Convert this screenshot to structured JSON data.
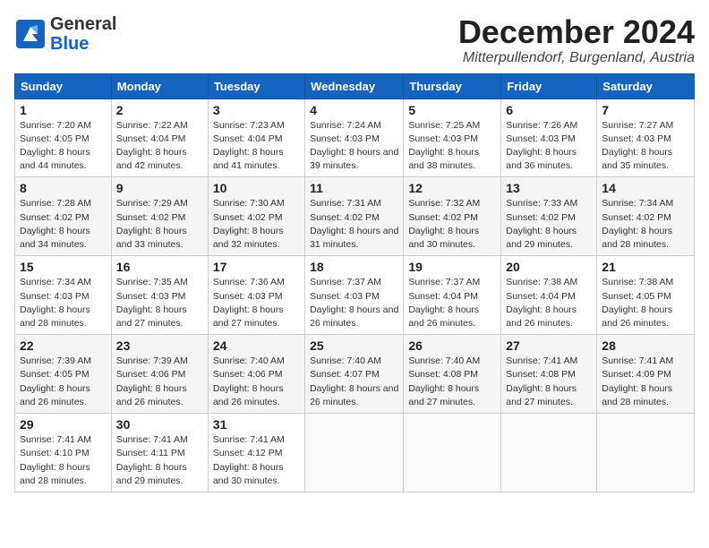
{
  "header": {
    "logo": {
      "general": "General",
      "blue": "Blue",
      "tagline": ""
    },
    "month": "December 2024",
    "location": "Mitterpullendorf, Burgenland, Austria"
  },
  "weekdays": [
    "Sunday",
    "Monday",
    "Tuesday",
    "Wednesday",
    "Thursday",
    "Friday",
    "Saturday"
  ],
  "weeks": [
    [
      {
        "day": "1",
        "sunrise": "Sunrise: 7:20 AM",
        "sunset": "Sunset: 4:05 PM",
        "daylight": "Daylight: 8 hours and 44 minutes."
      },
      {
        "day": "2",
        "sunrise": "Sunrise: 7:22 AM",
        "sunset": "Sunset: 4:04 PM",
        "daylight": "Daylight: 8 hours and 42 minutes."
      },
      {
        "day": "3",
        "sunrise": "Sunrise: 7:23 AM",
        "sunset": "Sunset: 4:04 PM",
        "daylight": "Daylight: 8 hours and 41 minutes."
      },
      {
        "day": "4",
        "sunrise": "Sunrise: 7:24 AM",
        "sunset": "Sunset: 4:03 PM",
        "daylight": "Daylight: 8 hours and 39 minutes."
      },
      {
        "day": "5",
        "sunrise": "Sunrise: 7:25 AM",
        "sunset": "Sunset: 4:03 PM",
        "daylight": "Daylight: 8 hours and 38 minutes."
      },
      {
        "day": "6",
        "sunrise": "Sunrise: 7:26 AM",
        "sunset": "Sunset: 4:03 PM",
        "daylight": "Daylight: 8 hours and 36 minutes."
      },
      {
        "day": "7",
        "sunrise": "Sunrise: 7:27 AM",
        "sunset": "Sunset: 4:03 PM",
        "daylight": "Daylight: 8 hours and 35 minutes."
      }
    ],
    [
      {
        "day": "8",
        "sunrise": "Sunrise: 7:28 AM",
        "sunset": "Sunset: 4:02 PM",
        "daylight": "Daylight: 8 hours and 34 minutes."
      },
      {
        "day": "9",
        "sunrise": "Sunrise: 7:29 AM",
        "sunset": "Sunset: 4:02 PM",
        "daylight": "Daylight: 8 hours and 33 minutes."
      },
      {
        "day": "10",
        "sunrise": "Sunrise: 7:30 AM",
        "sunset": "Sunset: 4:02 PM",
        "daylight": "Daylight: 8 hours and 32 minutes."
      },
      {
        "day": "11",
        "sunrise": "Sunrise: 7:31 AM",
        "sunset": "Sunset: 4:02 PM",
        "daylight": "Daylight: 8 hours and 31 minutes."
      },
      {
        "day": "12",
        "sunrise": "Sunrise: 7:32 AM",
        "sunset": "Sunset: 4:02 PM",
        "daylight": "Daylight: 8 hours and 30 minutes."
      },
      {
        "day": "13",
        "sunrise": "Sunrise: 7:33 AM",
        "sunset": "Sunset: 4:02 PM",
        "daylight": "Daylight: 8 hours and 29 minutes."
      },
      {
        "day": "14",
        "sunrise": "Sunrise: 7:34 AM",
        "sunset": "Sunset: 4:02 PM",
        "daylight": "Daylight: 8 hours and 28 minutes."
      }
    ],
    [
      {
        "day": "15",
        "sunrise": "Sunrise: 7:34 AM",
        "sunset": "Sunset: 4:03 PM",
        "daylight": "Daylight: 8 hours and 28 minutes."
      },
      {
        "day": "16",
        "sunrise": "Sunrise: 7:35 AM",
        "sunset": "Sunset: 4:03 PM",
        "daylight": "Daylight: 8 hours and 27 minutes."
      },
      {
        "day": "17",
        "sunrise": "Sunrise: 7:36 AM",
        "sunset": "Sunset: 4:03 PM",
        "daylight": "Daylight: 8 hours and 27 minutes."
      },
      {
        "day": "18",
        "sunrise": "Sunrise: 7:37 AM",
        "sunset": "Sunset: 4:03 PM",
        "daylight": "Daylight: 8 hours and 26 minutes."
      },
      {
        "day": "19",
        "sunrise": "Sunrise: 7:37 AM",
        "sunset": "Sunset: 4:04 PM",
        "daylight": "Daylight: 8 hours and 26 minutes."
      },
      {
        "day": "20",
        "sunrise": "Sunrise: 7:38 AM",
        "sunset": "Sunset: 4:04 PM",
        "daylight": "Daylight: 8 hours and 26 minutes."
      },
      {
        "day": "21",
        "sunrise": "Sunrise: 7:38 AM",
        "sunset": "Sunset: 4:05 PM",
        "daylight": "Daylight: 8 hours and 26 minutes."
      }
    ],
    [
      {
        "day": "22",
        "sunrise": "Sunrise: 7:39 AM",
        "sunset": "Sunset: 4:05 PM",
        "daylight": "Daylight: 8 hours and 26 minutes."
      },
      {
        "day": "23",
        "sunrise": "Sunrise: 7:39 AM",
        "sunset": "Sunset: 4:06 PM",
        "daylight": "Daylight: 8 hours and 26 minutes."
      },
      {
        "day": "24",
        "sunrise": "Sunrise: 7:40 AM",
        "sunset": "Sunset: 4:06 PM",
        "daylight": "Daylight: 8 hours and 26 minutes."
      },
      {
        "day": "25",
        "sunrise": "Sunrise: 7:40 AM",
        "sunset": "Sunset: 4:07 PM",
        "daylight": "Daylight: 8 hours and 26 minutes."
      },
      {
        "day": "26",
        "sunrise": "Sunrise: 7:40 AM",
        "sunset": "Sunset: 4:08 PM",
        "daylight": "Daylight: 8 hours and 27 minutes."
      },
      {
        "day": "27",
        "sunrise": "Sunrise: 7:41 AM",
        "sunset": "Sunset: 4:08 PM",
        "daylight": "Daylight: 8 hours and 27 minutes."
      },
      {
        "day": "28",
        "sunrise": "Sunrise: 7:41 AM",
        "sunset": "Sunset: 4:09 PM",
        "daylight": "Daylight: 8 hours and 28 minutes."
      }
    ],
    [
      {
        "day": "29",
        "sunrise": "Sunrise: 7:41 AM",
        "sunset": "Sunset: 4:10 PM",
        "daylight": "Daylight: 8 hours and 28 minutes."
      },
      {
        "day": "30",
        "sunrise": "Sunrise: 7:41 AM",
        "sunset": "Sunset: 4:11 PM",
        "daylight": "Daylight: 8 hours and 29 minutes."
      },
      {
        "day": "31",
        "sunrise": "Sunrise: 7:41 AM",
        "sunset": "Sunset: 4:12 PM",
        "daylight": "Daylight: 8 hours and 30 minutes."
      },
      null,
      null,
      null,
      null
    ]
  ]
}
